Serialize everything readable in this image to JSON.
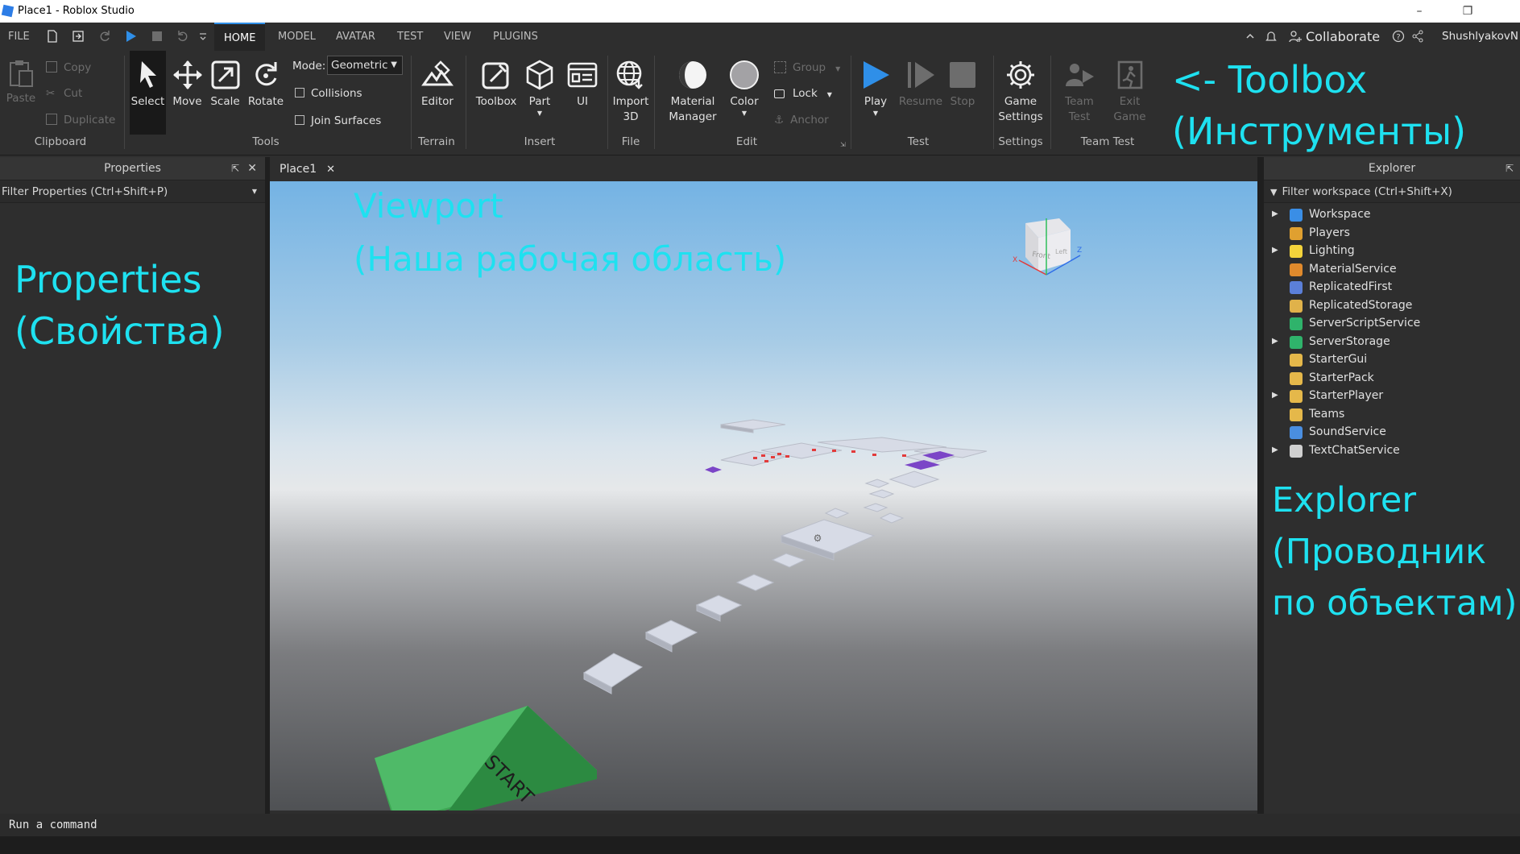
{
  "window": {
    "title": "Place1 - Roblox Studio"
  },
  "menu": {
    "file": "FILE",
    "tabs": [
      "HOME",
      "MODEL",
      "AVATAR",
      "TEST",
      "VIEW",
      "PLUGINS"
    ],
    "collaborate": "Collaborate",
    "username": "ShushlyakovN"
  },
  "ribbon": {
    "clipboard": {
      "paste": "Paste",
      "copy": "Copy",
      "cut": "Cut",
      "duplicate": "Duplicate",
      "group": "Clipboard"
    },
    "tools": {
      "select": "Select",
      "move": "Move",
      "scale": "Scale",
      "rotate": "Rotate",
      "mode_label": "Mode:",
      "mode_value": "Geometric",
      "collisions": "Collisions",
      "join_surfaces": "Join Surfaces",
      "group": "Tools"
    },
    "terrain": {
      "editor": "Editor",
      "group": "Terrain"
    },
    "insert": {
      "toolbox": "Toolbox",
      "part": "Part",
      "ui": "UI",
      "group": "Insert"
    },
    "file": {
      "import_line1": "Import",
      "import_line2": "3D",
      "group": "File"
    },
    "edit": {
      "material_line1": "Material",
      "material_line2": "Manager",
      "color": "Color",
      "group_btn": "Group",
      "lock": "Lock",
      "anchor": "Anchor",
      "group": "Edit"
    },
    "test": {
      "play": "Play",
      "resume": "Resume",
      "stop": "Stop",
      "group": "Test"
    },
    "settings": {
      "game_line1": "Game",
      "game_line2": "Settings",
      "group": "Settings"
    },
    "team_test": {
      "team_line1": "Team",
      "team_line2": "Test",
      "exit_line1": "Exit",
      "exit_line2": "Game",
      "group": "Team Test"
    }
  },
  "annotations": {
    "toolbox_line1": "<- Toolbox",
    "toolbox_line2": "(Инструменты)",
    "viewport_line1": "Viewport",
    "viewport_line2": "(Наша рабочая область)",
    "properties_line1": "Properties",
    "properties_line2": "(Свойства)",
    "explorer_line1": "Explorer",
    "explorer_line2": "(Проводник",
    "explorer_line3": "по объектам)"
  },
  "properties": {
    "title": "Properties",
    "filter": "Filter Properties (Ctrl+Shift+P)"
  },
  "document": {
    "tab": "Place1"
  },
  "viewport": {
    "start_label": "START",
    "cube_face1": "Front",
    "cube_face2": "Left",
    "axis_x": "X",
    "axis_z": "Z"
  },
  "explorer": {
    "title": "Explorer",
    "filter": "Filter workspace (Ctrl+Shift+X)",
    "items": [
      {
        "label": "Workspace",
        "expandable": true,
        "color": "#3a8ee6"
      },
      {
        "label": "Players",
        "expandable": false,
        "color": "#e0a030"
      },
      {
        "label": "Lighting",
        "expandable": true,
        "color": "#f3d33b"
      },
      {
        "label": "MaterialService",
        "expandable": false,
        "color": "#e08a2c"
      },
      {
        "label": "ReplicatedFirst",
        "expandable": false,
        "color": "#5b7fd8"
      },
      {
        "label": "ReplicatedStorage",
        "expandable": false,
        "color": "#e0b24a"
      },
      {
        "label": "ServerScriptService",
        "expandable": false,
        "color": "#2fb36b"
      },
      {
        "label": "ServerStorage",
        "expandable": true,
        "color": "#2fb36b"
      },
      {
        "label": "StarterGui",
        "expandable": false,
        "color": "#e5b84a"
      },
      {
        "label": "StarterPack",
        "expandable": false,
        "color": "#e5b84a"
      },
      {
        "label": "StarterPlayer",
        "expandable": true,
        "color": "#e5b84a"
      },
      {
        "label": "Teams",
        "expandable": false,
        "color": "#e5b84a"
      },
      {
        "label": "SoundService",
        "expandable": false,
        "color": "#4a8ee0"
      },
      {
        "label": "TextChatService",
        "expandable": true,
        "color": "#d0d0d0"
      }
    ]
  },
  "command": {
    "placeholder": "Run a command"
  }
}
